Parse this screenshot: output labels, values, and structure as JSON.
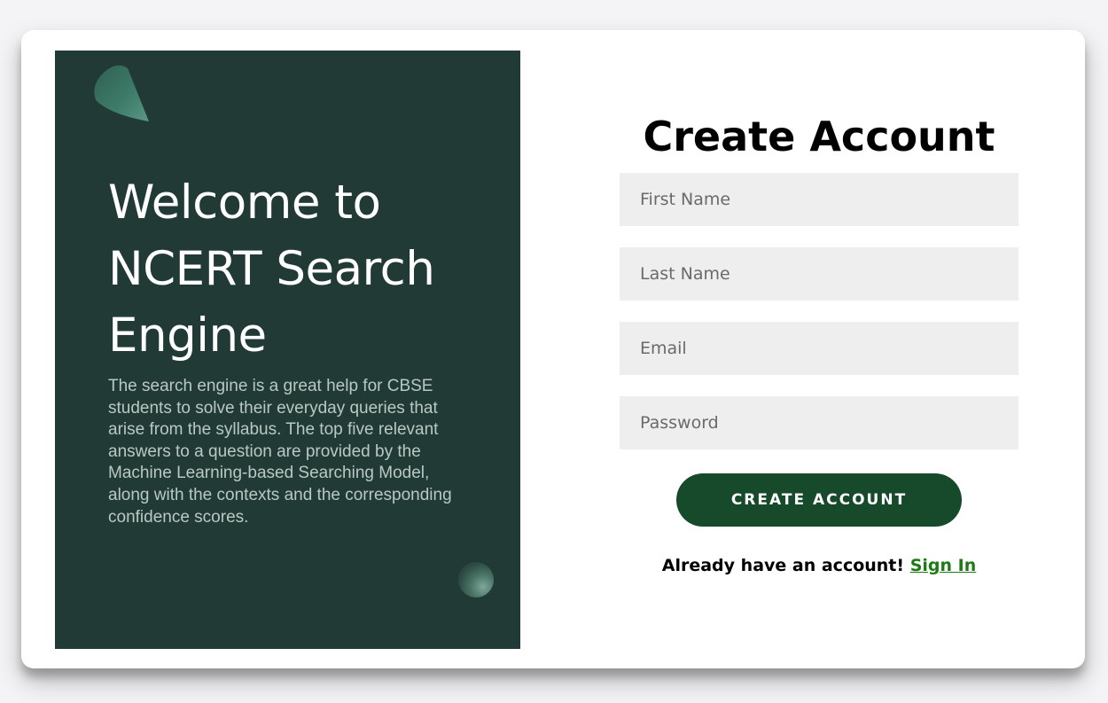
{
  "welcome": {
    "title": "Welcome to NCERT Search Engine",
    "description": "The search engine is a great help for CBSE students to solve their everyday queries that arise from the syllabus. The top five relevant answers to a question are provided by the Machine Learning-based Searching Model, along with the contexts and the corresponding confidence scores."
  },
  "form": {
    "title": "Create Account",
    "fields": {
      "first_name": {
        "placeholder": "First Name",
        "value": ""
      },
      "last_name": {
        "placeholder": "Last Name",
        "value": ""
      },
      "email": {
        "placeholder": "Email",
        "value": ""
      },
      "password": {
        "placeholder": "Password",
        "value": ""
      }
    },
    "submit_label": "CREATE ACCOUNT",
    "signin_prompt": "Already have an account!",
    "signin_link": "Sign In"
  },
  "colors": {
    "panel_background": "#223a35",
    "button_background": "#174a2a",
    "link_color": "#1e7a14",
    "field_background": "#eeeeee"
  },
  "icons": {
    "decor_top": "cone-shape",
    "decor_bottom": "sphere-shape"
  }
}
